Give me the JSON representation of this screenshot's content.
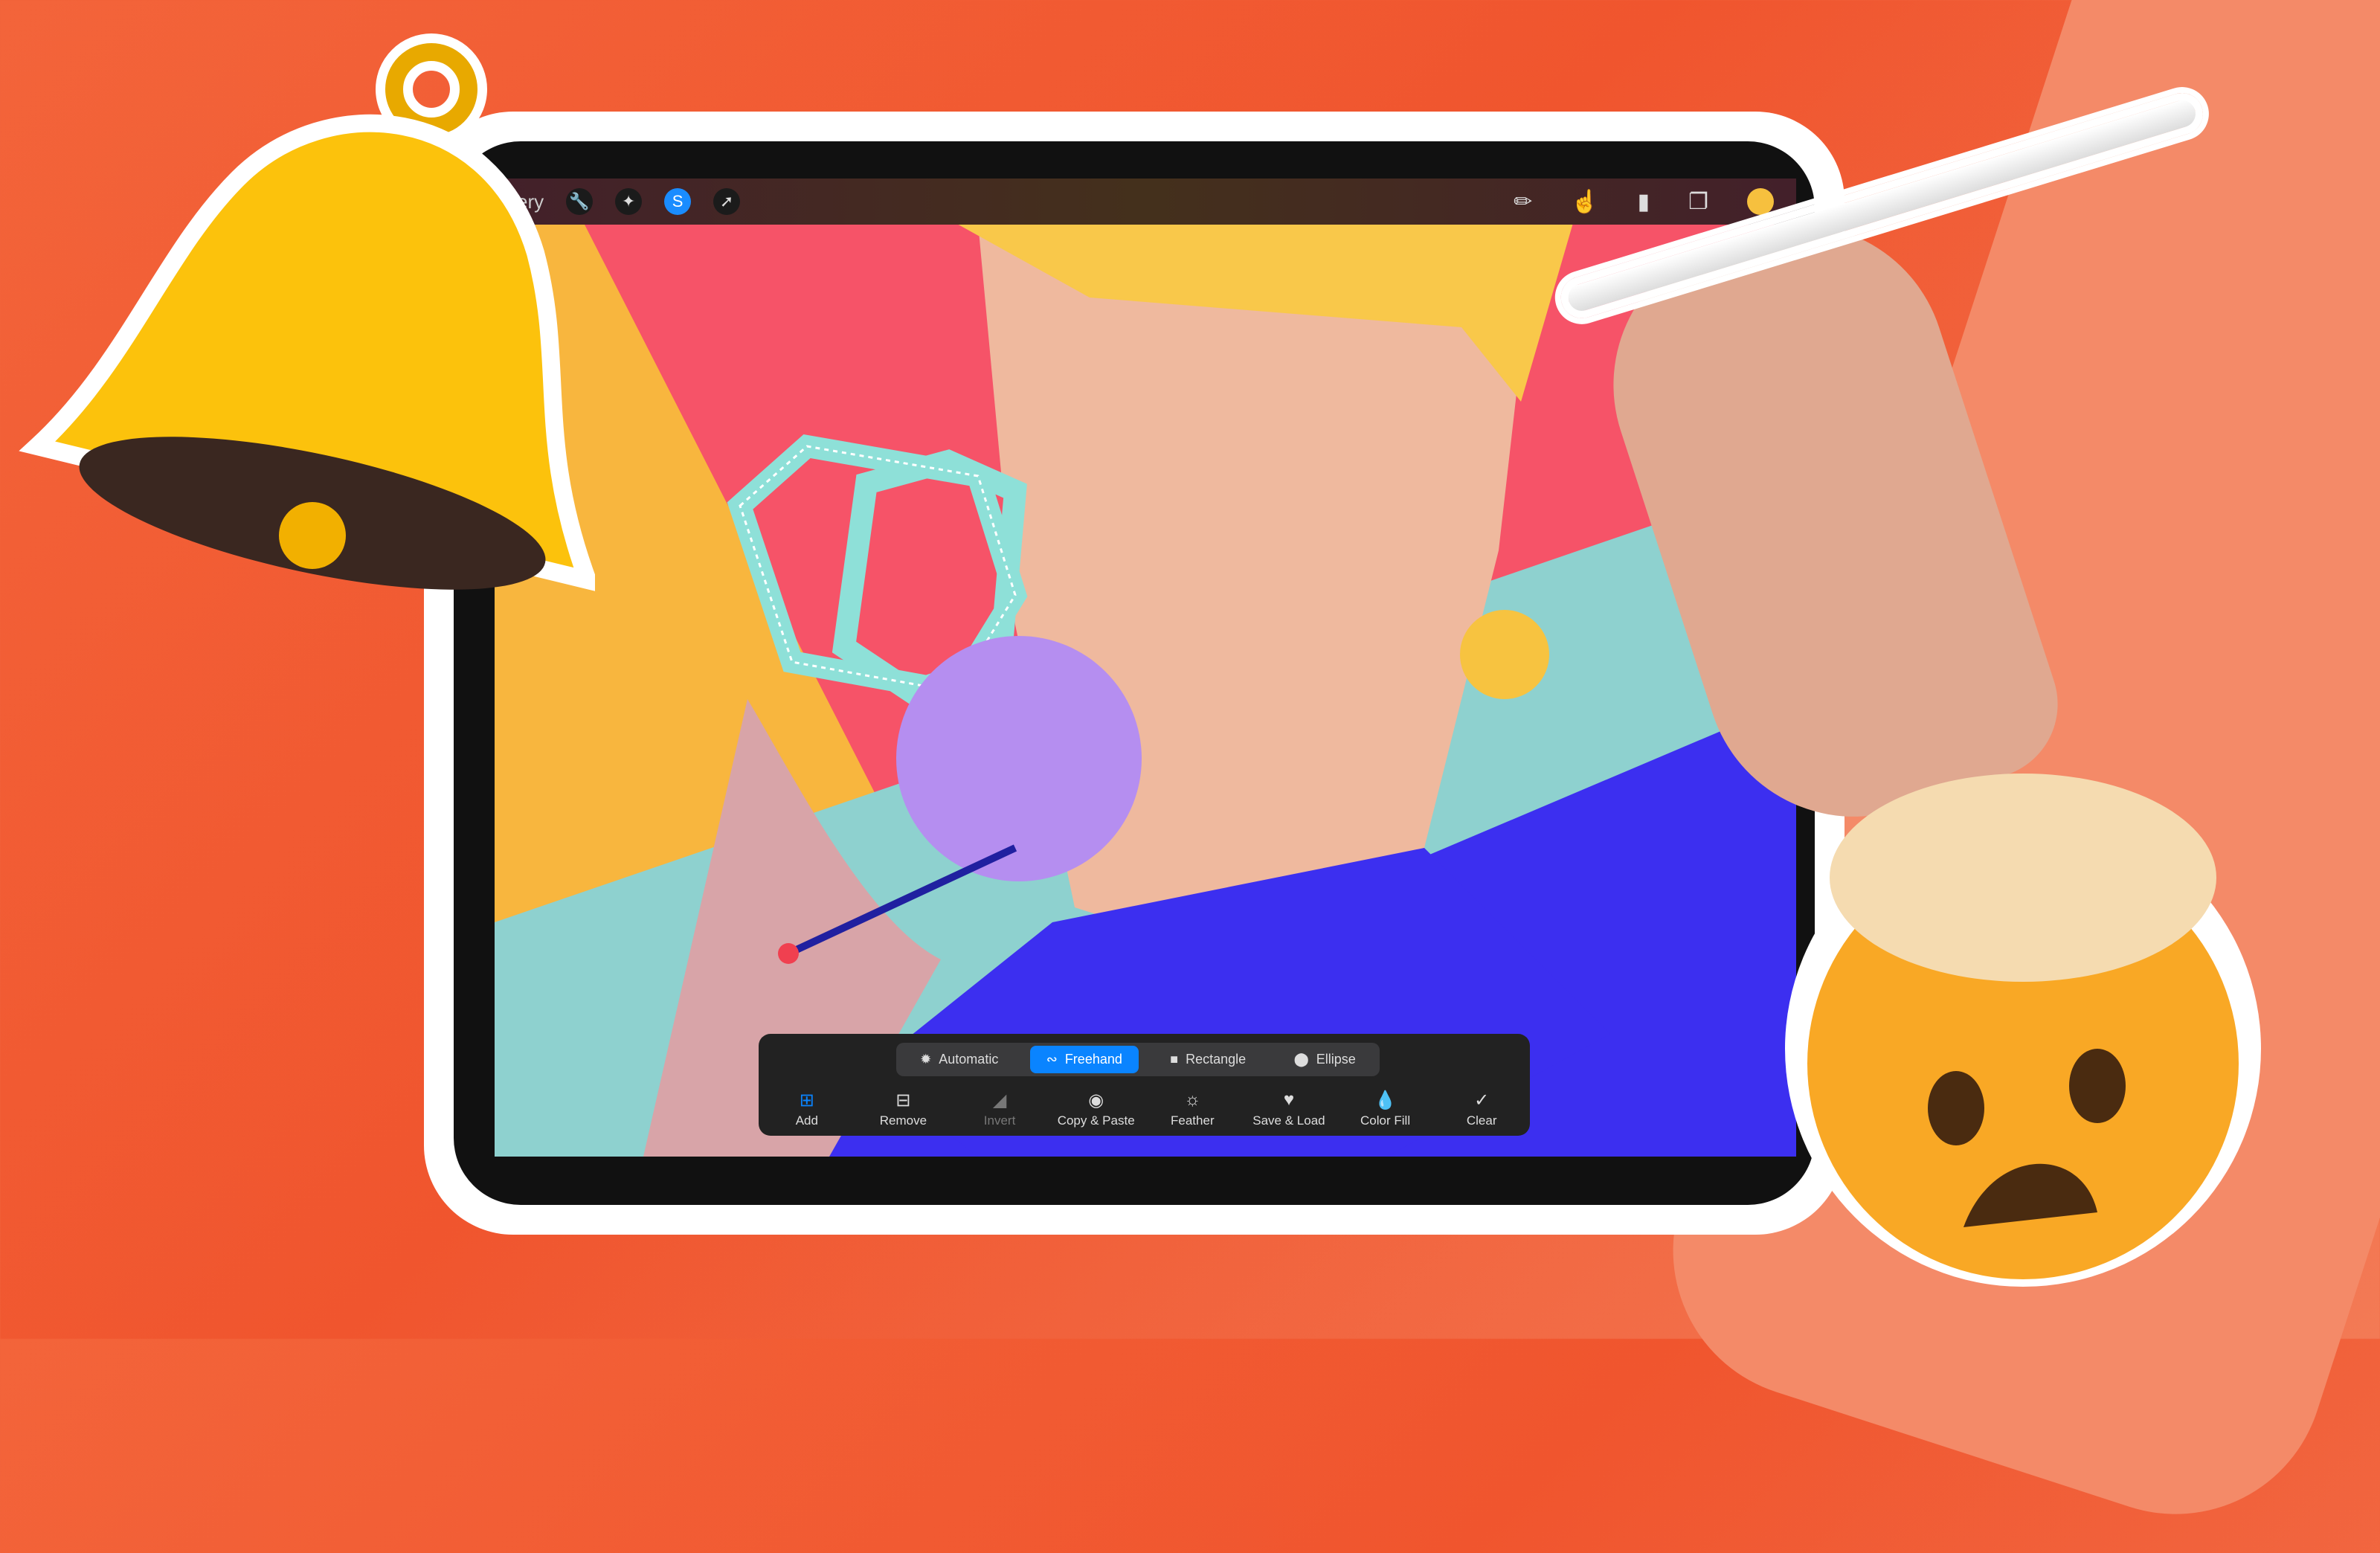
{
  "toolbar": {
    "gallery_label": "ery",
    "left_tools": [
      "wrench-icon",
      "magic-wand-icon",
      "selection-icon",
      "transform-arrow-icon"
    ],
    "right_tools": [
      "brush-icon",
      "smudge-icon",
      "eraser-icon",
      "layers-icon"
    ],
    "color": "#f6c03e"
  },
  "selection_panel": {
    "modes": [
      {
        "label": "Automatic",
        "icon": "automatic-icon"
      },
      {
        "label": "Freehand",
        "icon": "freehand-icon",
        "active": true
      },
      {
        "label": "Rectangle",
        "icon": "rectangle-icon"
      },
      {
        "label": "Ellipse",
        "icon": "ellipse-icon"
      }
    ],
    "actions": [
      {
        "label": "Add"
      },
      {
        "label": "Remove"
      },
      {
        "label": "Invert",
        "disabled": true
      },
      {
        "label": "Copy & Paste"
      },
      {
        "label": "Feather"
      },
      {
        "label": "Save & Load"
      },
      {
        "label": "Color Fill"
      },
      {
        "label": "Clear"
      }
    ]
  },
  "colors": {
    "accent": "#0a84ff",
    "background": "#f0552e"
  }
}
